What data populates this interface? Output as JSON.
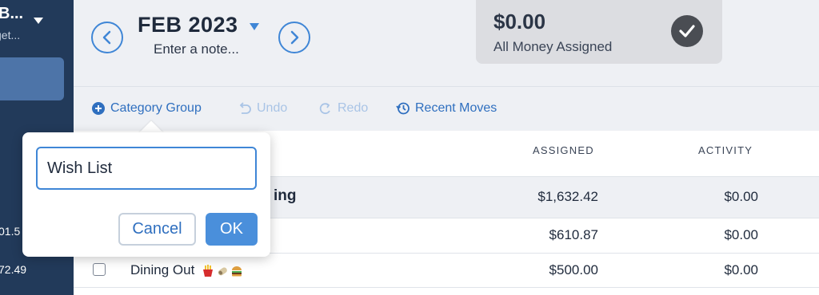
{
  "sidebar": {
    "budget_name": "B...",
    "budget_sub": "get...",
    "accounts": [
      "01.5",
      "72.49"
    ]
  },
  "header": {
    "month": "FEB 2023",
    "note_placeholder": "Enter a note...",
    "assigned_amount": "$0.00",
    "assigned_label": "All Money Assigned"
  },
  "toolbar": {
    "category_group": "Category Group",
    "undo": "Undo",
    "redo": "Redo",
    "recent_moves": "Recent Moves"
  },
  "table": {
    "columns": {
      "assigned": "ASSIGNED",
      "activity": "ACTIVITY"
    },
    "group_row": {
      "name_fragment": "ing",
      "assigned": "$1,632.42",
      "activity": "$0.00"
    },
    "rows": [
      {
        "name": "",
        "assigned": "$610.87",
        "activity": "$0.00"
      },
      {
        "name": "Dining Out",
        "assigned": "$500.00",
        "activity": "$0.00"
      }
    ]
  },
  "popup": {
    "input_value": "Wish List",
    "cancel_label": "Cancel",
    "ok_label": "OK"
  },
  "colors": {
    "accent": "#3f86d6",
    "sidebar": "#223a5a",
    "ok_button": "#4a8fdb"
  }
}
